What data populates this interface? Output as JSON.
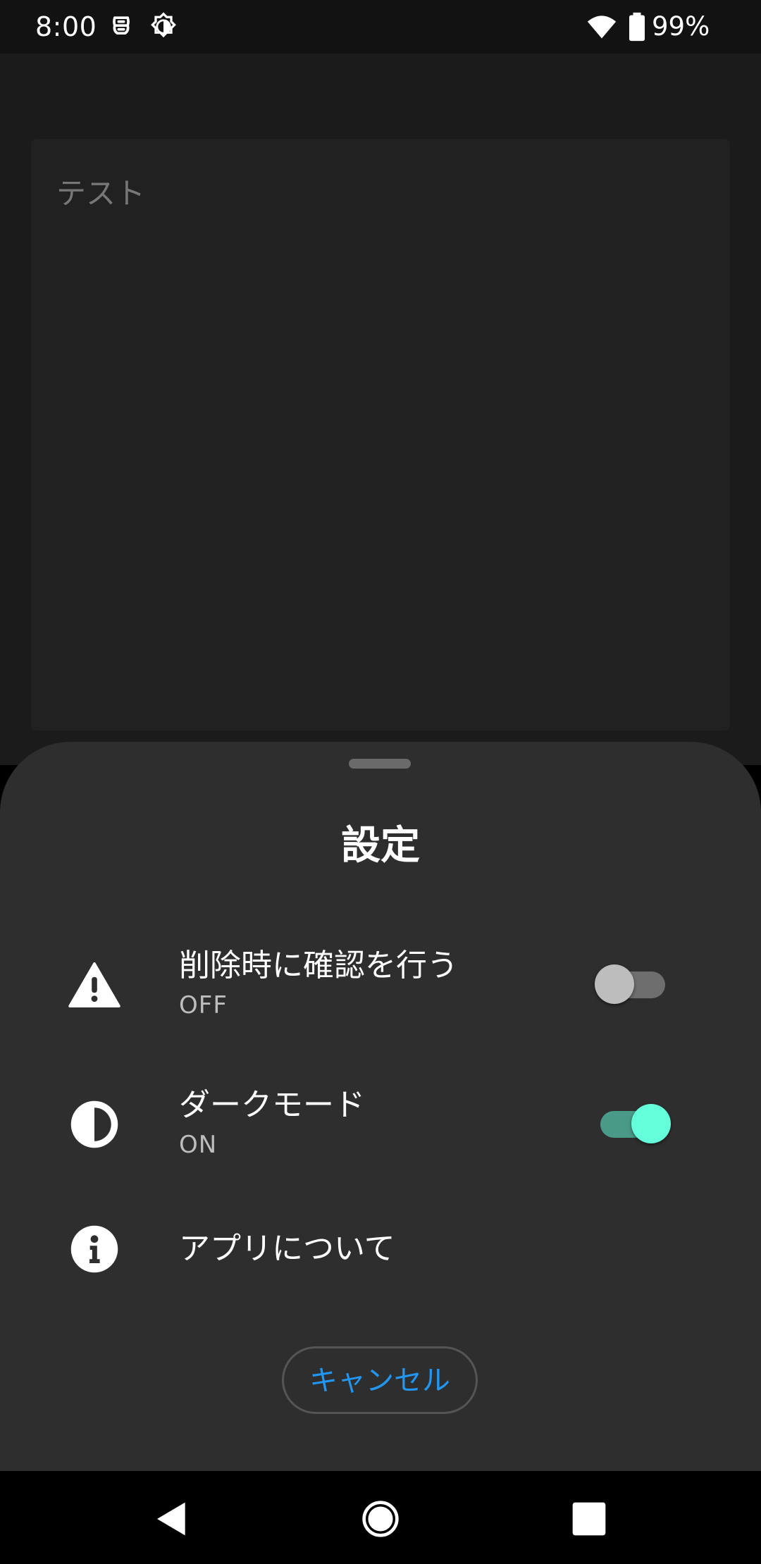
{
  "status_bar": {
    "time": "8:00",
    "icons": [
      "data-saver-icon",
      "brightness-icon",
      "wifi-icon",
      "battery-icon"
    ],
    "battery_percent": "99%"
  },
  "background_app": {
    "note_title": "テスト"
  },
  "sheet": {
    "title": "設定",
    "items": [
      {
        "icon": "warning-icon",
        "title": "削除時に確認を行う",
        "subtitle": "OFF",
        "toggle_on": false
      },
      {
        "icon": "contrast-icon",
        "title": "ダークモード",
        "subtitle": "ON",
        "toggle_on": true
      },
      {
        "icon": "info-icon",
        "title": "アプリについて"
      }
    ],
    "cancel_label": "キャンセル"
  },
  "colors": {
    "accent": "#2196f3",
    "switch_on_thumb": "#64ffda",
    "switch_on_track": "#4a9a88",
    "switch_off_thumb": "#bdbdbd",
    "switch_off_track": "#6e6e6e",
    "sheet_bg": "#2e2e2e"
  },
  "nav_bar": {
    "buttons": [
      "back-icon",
      "home-icon",
      "recents-icon"
    ]
  }
}
